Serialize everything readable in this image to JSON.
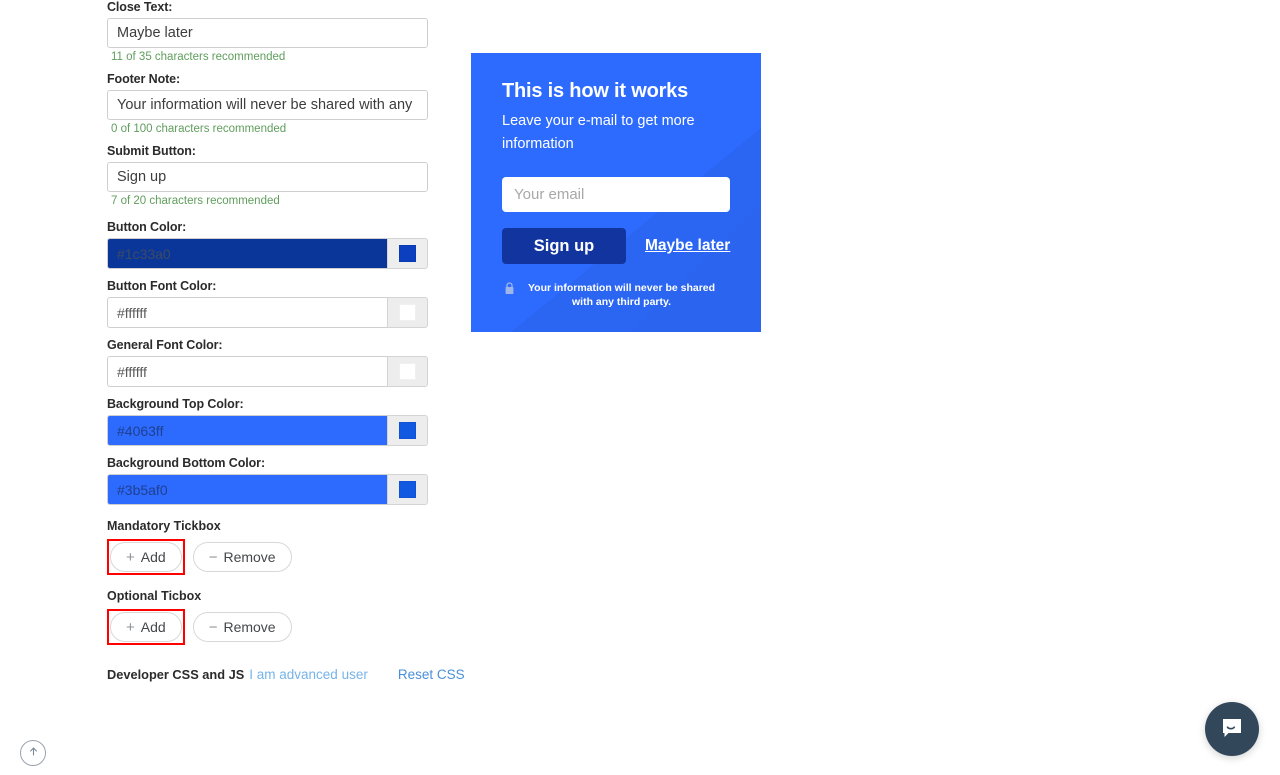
{
  "settings": {
    "fields": [
      {
        "label": "Close Text:",
        "value": "Maybe later",
        "placeholder": "Maybe later",
        "helper": "11 of 35 characters recommended"
      },
      {
        "label": "Footer Note:",
        "value": "Your information will never be shared with any",
        "placeholder": "Your information will never be shared with any",
        "helper": "0 of 100 characters recommended"
      },
      {
        "label": "Submit Button:",
        "value": "Sign up",
        "placeholder": "Sign up",
        "helper": "7 of 20 characters recommended"
      }
    ],
    "colors": [
      {
        "label": "Button Color:",
        "value": "#1c33a0",
        "field_bg": "#0b3699",
        "field_text": "#3d4b63",
        "chip": "#0b3fbf",
        "swatch_bg": "#eeeeee"
      },
      {
        "label": "Button Font Color:",
        "value": "#ffffff",
        "field_bg": "#ffffff",
        "field_text": "#5a5a5a",
        "chip": "#ffffff",
        "swatch_bg": "#ededed"
      },
      {
        "label": "General Font Color:",
        "value": "#ffffff",
        "field_bg": "#ffffff",
        "field_text": "#5a5a5a",
        "chip": "#ffffff",
        "swatch_bg": "#ededed"
      },
      {
        "label": "Background Top Color:",
        "value": "#4063ff",
        "field_bg": "#2d6bff",
        "field_text": "#1f3f8f",
        "chip": "#1159e0",
        "swatch_bg": "#ededed"
      },
      {
        "label": "Background Bottom Color:",
        "value": "#3b5af0",
        "field_bg": "#2d6bff",
        "field_text": "#1f3f8f",
        "chip": "#1159e0",
        "swatch_bg": "#ededed"
      }
    ],
    "tickboxes": [
      {
        "label": "Mandatory Tickbox",
        "add_label": "Add",
        "remove_label": "Remove",
        "add_sign": "+",
        "remove_sign": "−",
        "highlighted": true
      },
      {
        "label": "Optional Ticbox",
        "add_label": "Add",
        "remove_label": "Remove",
        "add_sign": "+",
        "remove_sign": "−",
        "highlighted": true
      }
    ],
    "developer": {
      "title": "Developer CSS and JS",
      "advanced_link": "I am advanced user",
      "reset_link": "Reset CSS"
    }
  },
  "preview": {
    "title": "This is how it works",
    "subtitle": "Leave your e-mail to get more information",
    "email_placeholder": "Your email",
    "email_value": "",
    "submit_label": "Sign up",
    "close_label": "Maybe later",
    "footer_note": "Your information will never be shared with any third party.",
    "lock_icon": "lock-icon",
    "background_color": "#2d6bff",
    "button_color": "#12349e"
  },
  "widgets": {
    "scroll_top_icon": "arrow-up-icon",
    "chat_icon": "chat-bubble-icon"
  },
  "highlight_color": "#ff0000"
}
